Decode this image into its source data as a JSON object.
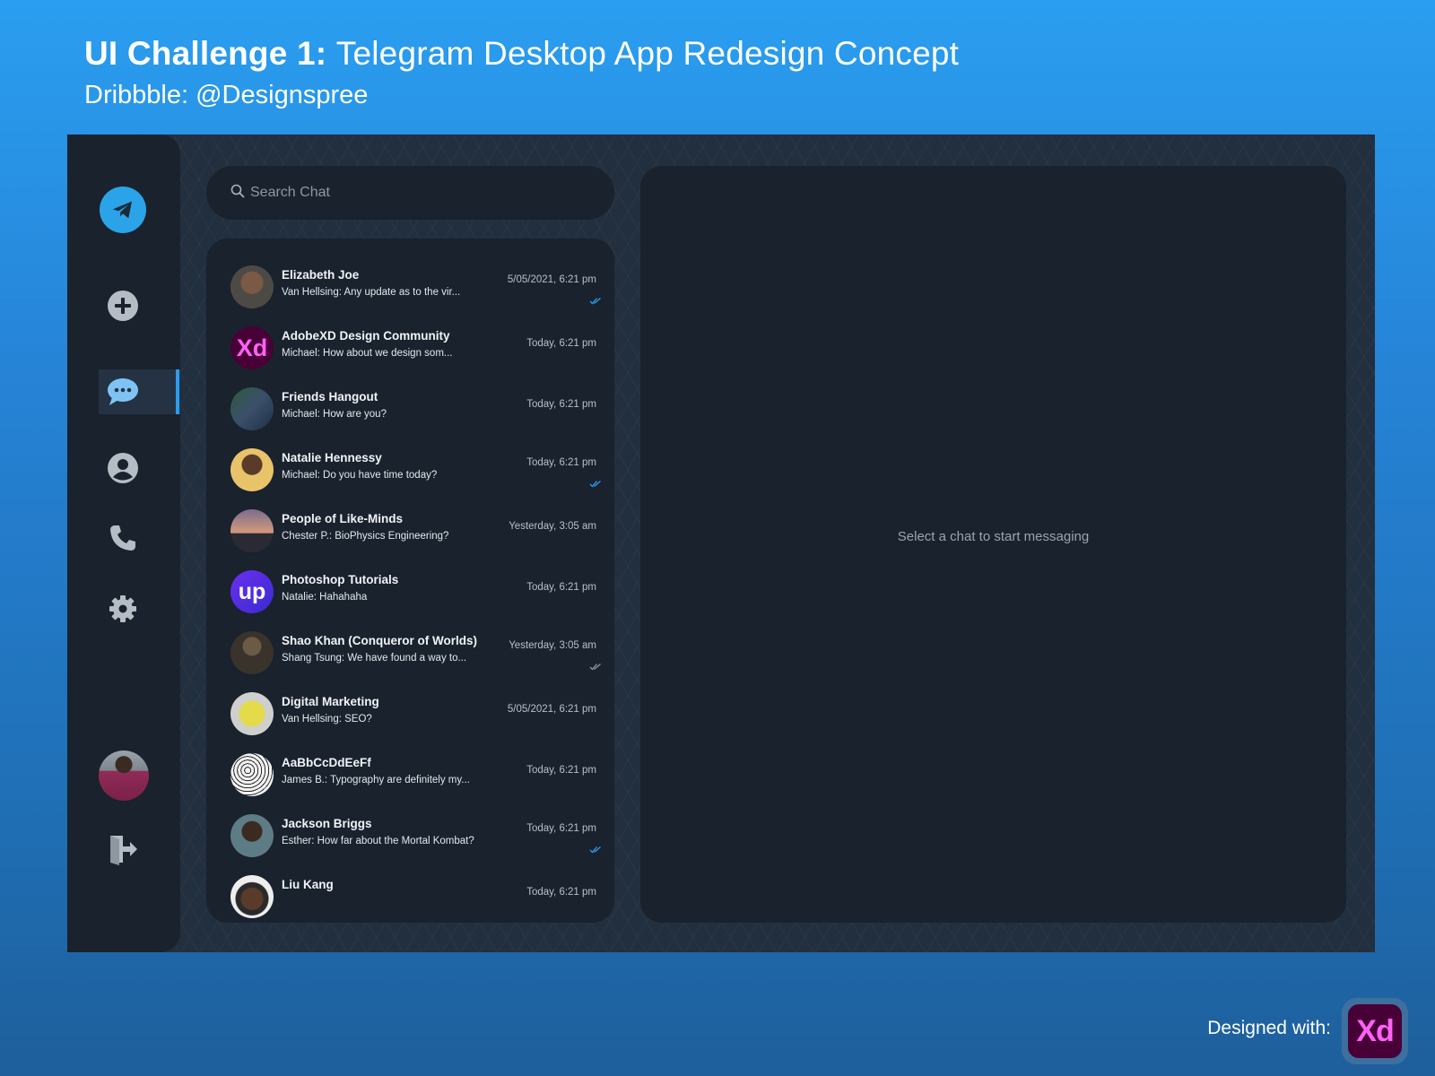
{
  "header": {
    "title_strong": "UI Challenge 1:",
    "title_rest": "Telegram Desktop App Redesign Concept",
    "subtitle": "Dribbble: @Designspree"
  },
  "sidebar": {
    "items": [
      {
        "icon": "telegram-logo-icon"
      },
      {
        "icon": "plus-circle-icon"
      },
      {
        "icon": "chat-bubble-icon",
        "active": true
      },
      {
        "icon": "user-profile-icon"
      },
      {
        "icon": "phone-icon"
      },
      {
        "icon": "gear-icon"
      },
      {
        "icon": "user-avatar"
      },
      {
        "icon": "logout-icon"
      }
    ]
  },
  "search": {
    "placeholder": "Search Chat",
    "icon": "search-icon"
  },
  "chats": [
    {
      "name": "Elizabeth Joe",
      "preview": "Van Hellsing: Any update as to the vir...",
      "time": "5/05/2021, 6:21 pm",
      "read": true,
      "avatar": "photo",
      "avatar_color": "#6b4f3b"
    },
    {
      "name": "AdobeXD Design Community",
      "preview": "Michael: How about we design som...",
      "time": "Today, 6:21 pm",
      "read": false,
      "avatar": "Xd",
      "avatar_color": "#470137"
    },
    {
      "name": "Friends Hangout",
      "preview": "Michael: How are you?",
      "time": "Today, 6:21 pm",
      "read": false,
      "avatar": "photo",
      "avatar_color": "#2f4a57"
    },
    {
      "name": "Natalie Hennessy",
      "preview": "Michael: Do you have time today?",
      "time": "Today, 6:21 pm",
      "read": true,
      "avatar": "photo",
      "avatar_color": "#d2a15a"
    },
    {
      "name": "People of Like-Minds",
      "preview": "Chester P.: BioPhysics Engineering?",
      "time": "Yesterday, 3:05 am",
      "read": false,
      "avatar": "photo",
      "avatar_color": "#b98468"
    },
    {
      "name": "Photoshop Tutorials",
      "preview": "Natalie: Hahahaha",
      "time": "Today, 6:21 pm",
      "read": false,
      "avatar": "up",
      "avatar_color": "#4b2ae0"
    },
    {
      "name": "Shao Khan (Conqueror of Worlds)",
      "preview": "Shang Tsung: We have found a way to...",
      "time": "Yesterday, 3:05 am",
      "read": true,
      "read_muted": true,
      "avatar": "photo",
      "avatar_color": "#4a4136"
    },
    {
      "name": "Digital Marketing",
      "preview": "Van Hellsing: SEO?",
      "time": "5/05/2021, 6:21 pm",
      "read": false,
      "avatar": "photo",
      "avatar_color": "#d9d24a"
    },
    {
      "name": "AaBbCcDdEeFf",
      "preview": "James B.: Typography are definitely my...",
      "time": "Today, 6:21 pm",
      "read": false,
      "avatar": "photo",
      "avatar_color": "#e9e9e9"
    },
    {
      "name": "Jackson Briggs",
      "preview": "Esther: How far about the Mortal Kombat?",
      "time": "Today, 6:21 pm",
      "read": true,
      "avatar": "photo",
      "avatar_color": "#3a5560"
    },
    {
      "name": "Liu Kang",
      "preview": "",
      "time": "Today, 6:21 pm",
      "read": false,
      "avatar": "photo",
      "avatar_color": "#e6e6e6"
    }
  ],
  "conversation": {
    "empty_message": "Select a chat to start messaging"
  },
  "footer": {
    "label": "Designed with:",
    "badge_text": "Xd"
  },
  "colors": {
    "accent": "#2b9df0",
    "panel": "#19222d",
    "background": "#222f3f",
    "xd_pink": "#ff61f6",
    "xd_bg": "#470137"
  }
}
